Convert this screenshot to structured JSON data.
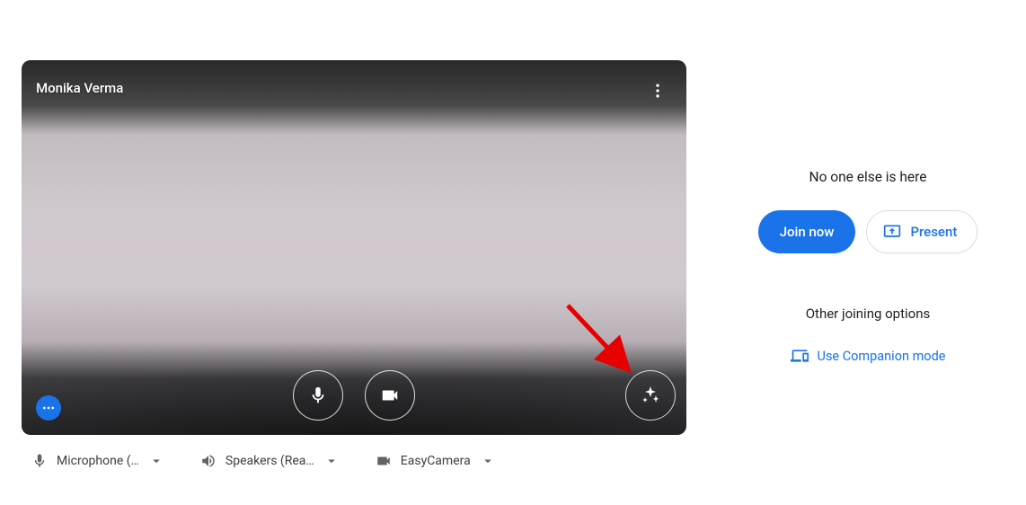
{
  "video": {
    "participant_name": "Monika Verma"
  },
  "devices": {
    "mic_label": "Microphone (…",
    "speaker_label": "Speakers (Rea…",
    "camera_label": "EasyCamera"
  },
  "right": {
    "status": "No one else is here",
    "join_label": "Join now",
    "present_label": "Present",
    "other_title": "Other joining options",
    "companion_label": "Use Companion mode"
  }
}
